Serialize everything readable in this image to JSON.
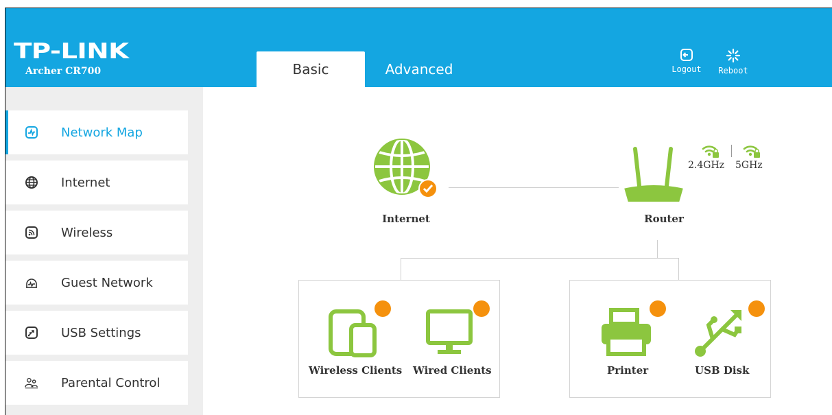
{
  "brand": {
    "logo": "TP-LINK",
    "model": "Archer CR700"
  },
  "tabs": [
    {
      "label": "Basic",
      "active": true
    },
    {
      "label": "Advanced",
      "active": false
    }
  ],
  "header_buttons": {
    "logout": "Logout",
    "reboot": "Reboot"
  },
  "sidebar": {
    "items": [
      {
        "label": "Network Map",
        "icon": "network-map-icon",
        "active": true
      },
      {
        "label": "Internet",
        "icon": "globe-icon",
        "active": false
      },
      {
        "label": "Wireless",
        "icon": "wireless-icon",
        "active": false
      },
      {
        "label": "Guest Network",
        "icon": "guest-network-icon",
        "active": false
      },
      {
        "label": "USB Settings",
        "icon": "usb-settings-icon",
        "active": false
      },
      {
        "label": "Parental Control",
        "icon": "parental-control-icon",
        "active": false
      }
    ]
  },
  "network_map": {
    "internet": {
      "label": "Internet",
      "status": "connected"
    },
    "router": {
      "label": "Router",
      "bands": [
        "2.4GHz",
        "5GHz"
      ]
    },
    "clients": {
      "wireless": "Wireless Clients",
      "wired": "Wired Clients"
    },
    "devices": {
      "printer": "Printer",
      "usb_disk": "USB Disk"
    }
  },
  "colors": {
    "brand_blue": "#14a6e1",
    "device_green": "#8cc63f",
    "badge_orange": "#f5910d",
    "sidebar_bg": "#eeeeee"
  }
}
